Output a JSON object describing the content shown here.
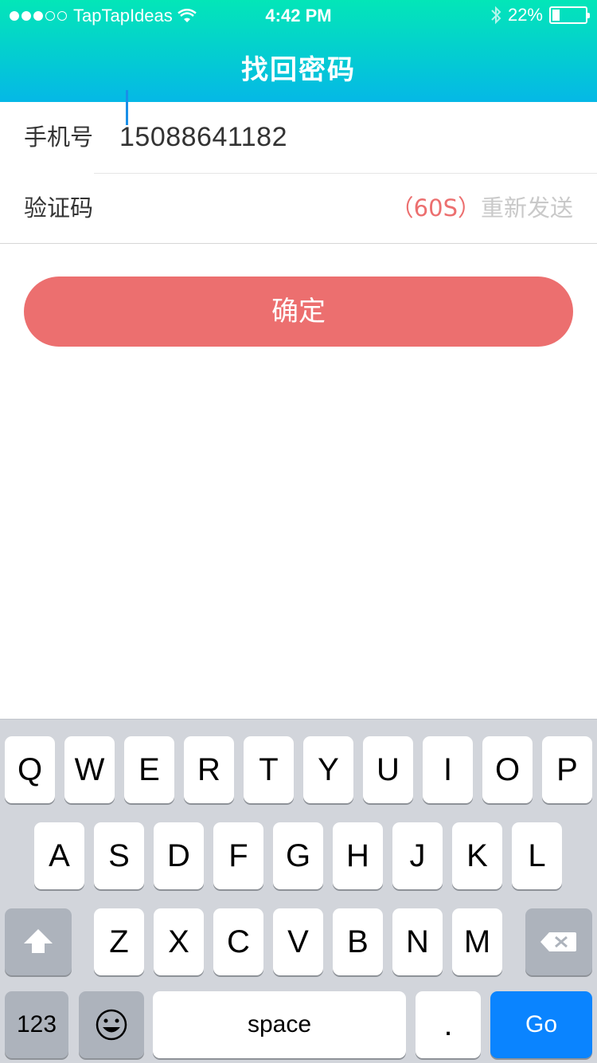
{
  "status_bar": {
    "carrier": "TapTapIdeas",
    "time": "4:42 PM",
    "battery": "22%",
    "battery_level": 0.22
  },
  "header": {
    "title": "找回密码"
  },
  "form": {
    "phone_label": "手机号",
    "phone_value": "15088641182",
    "code_label": "验证码",
    "code_value": "",
    "resend_count": "（60S）",
    "resend_text": "重新发送"
  },
  "confirm_label": "确定",
  "keyboard": {
    "row1": [
      "Q",
      "W",
      "E",
      "R",
      "T",
      "Y",
      "U",
      "I",
      "O",
      "P"
    ],
    "row2": [
      "A",
      "S",
      "D",
      "F",
      "G",
      "H",
      "J",
      "K",
      "L"
    ],
    "row3": [
      "Z",
      "X",
      "C",
      "V",
      "B",
      "N",
      "M"
    ],
    "numbers_label": "123",
    "space_label": "space",
    "period_label": ".",
    "go_label": "Go"
  },
  "colors": {
    "header_gradient_top": "#03e6b8",
    "header_gradient_bottom": "#05b8e6",
    "accent_red": "#ec6f6f",
    "go_blue": "#0a84ff"
  }
}
